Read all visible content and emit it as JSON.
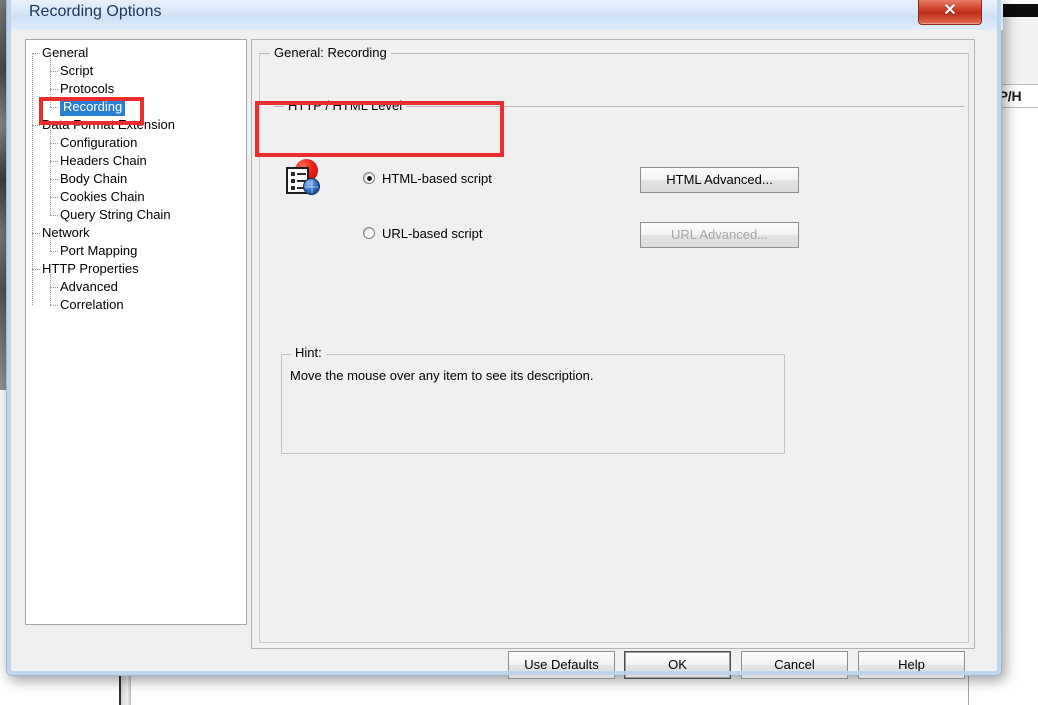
{
  "window": {
    "title": "Recording Options",
    "close_label": "✕"
  },
  "tree": {
    "items": [
      {
        "label": "General",
        "depth": 0,
        "selected": false
      },
      {
        "label": "Script",
        "depth": 1,
        "selected": false
      },
      {
        "label": "Protocols",
        "depth": 1,
        "selected": false
      },
      {
        "label": "Recording",
        "depth": 1,
        "selected": true
      },
      {
        "label": "Data Format Extension",
        "depth": 0,
        "selected": false
      },
      {
        "label": "Configuration",
        "depth": 1,
        "selected": false
      },
      {
        "label": "Headers Chain",
        "depth": 1,
        "selected": false
      },
      {
        "label": "Body Chain",
        "depth": 1,
        "selected": false
      },
      {
        "label": "Cookies Chain",
        "depth": 1,
        "selected": false
      },
      {
        "label": "Query String Chain",
        "depth": 1,
        "selected": false
      },
      {
        "label": "Network",
        "depth": 0,
        "selected": false
      },
      {
        "label": "Port Mapping",
        "depth": 1,
        "selected": false
      },
      {
        "label": "HTTP Properties",
        "depth": 0,
        "selected": false
      },
      {
        "label": "Advanced",
        "depth": 1,
        "selected": false
      },
      {
        "label": "Correlation",
        "depth": 1,
        "selected": false
      }
    ],
    "selection_color": "#2a7fd4"
  },
  "content": {
    "group_title": "General: Recording",
    "http_group_title": "HTTP / HTML Level",
    "options": [
      {
        "label": "HTML-based script",
        "selected": true
      },
      {
        "label": "URL-based script",
        "selected": false
      }
    ],
    "advanced_buttons": [
      {
        "label": "HTML Advanced...",
        "enabled": true
      },
      {
        "label": "URL Advanced...",
        "enabled": false
      }
    ],
    "script_icon": "html-script-icon",
    "hint": {
      "title": "Hint:",
      "text": "Move the mouse over any item to see its description."
    }
  },
  "footer": {
    "buttons": [
      {
        "label": "Use Defaults",
        "default": false
      },
      {
        "label": "OK",
        "default": true
      },
      {
        "label": "Cancel",
        "default": false
      },
      {
        "label": "Help",
        "default": false
      }
    ]
  },
  "annotations": {
    "color": "#ec2d2d",
    "regions": [
      "tree-recording-item",
      "html-based-script-option"
    ]
  },
  "background": {
    "partial_label": "HTTP/H"
  }
}
